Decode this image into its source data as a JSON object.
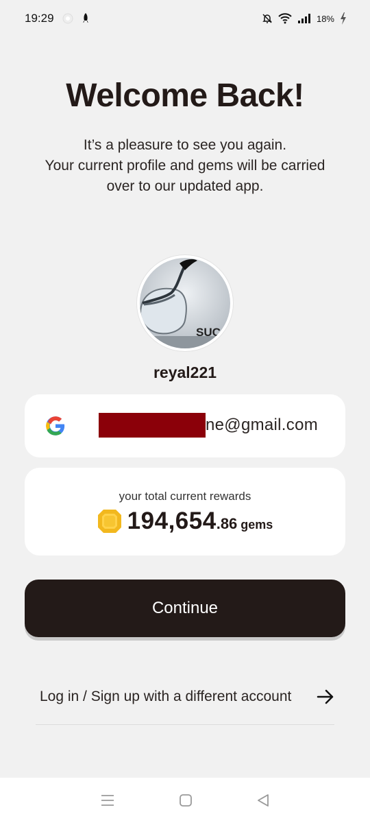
{
  "status_bar": {
    "time": "19:29",
    "battery": "18%",
    "icons": [
      "notification-dot-icon",
      "rocket-icon",
      "bell-off-icon",
      "wifi-icon",
      "signal-icon",
      "battery-charging-icon"
    ]
  },
  "header": {
    "title": "Welcome Back!",
    "subtitle_lines": [
      "It’s a pleasure to see you again.",
      "Your current profile and gems will be carried",
      "over to our updated app."
    ]
  },
  "profile": {
    "username": "reyal221",
    "avatar_text": "SUC"
  },
  "account": {
    "provider_icon": "google-icon",
    "email_visible": "ne@gmail.com"
  },
  "rewards": {
    "label": "your total current rewards",
    "gems_integer": "194,654",
    "gems_decimal": ".86",
    "gems_unit": "gems",
    "gem_icon": "gem-icon",
    "gem_color": "#f2b81e"
  },
  "actions": {
    "continue_label": "Continue",
    "alt_login_label": "Log in / Sign up with a different account"
  },
  "nav": {
    "items": [
      "menu-icon",
      "home-icon",
      "back-icon"
    ]
  },
  "colors": {
    "background": "#f1f1f1",
    "primary": "#231a18",
    "card": "#ffffff",
    "redaction": "#8b0009"
  }
}
